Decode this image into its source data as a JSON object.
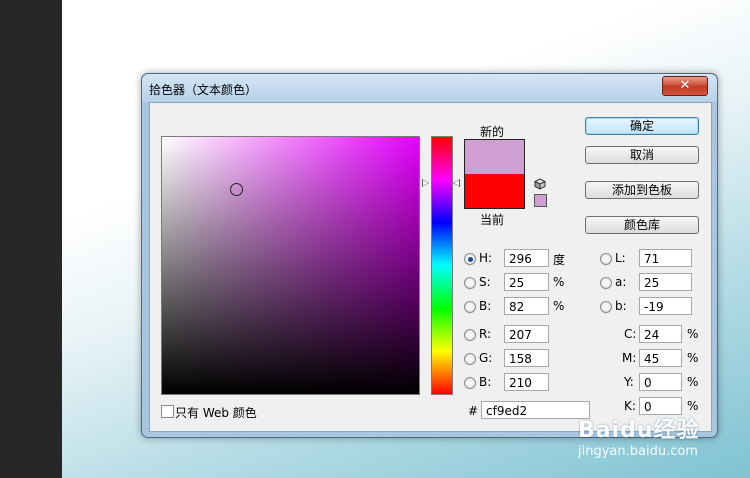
{
  "dialog": {
    "title": "拾色器（文本颜色）",
    "close_glyph": "✕"
  },
  "preview": {
    "new_label": "新的",
    "current_label": "当前",
    "new_color": "#cf9ed2",
    "current_color": "#ff0000"
  },
  "buttons": {
    "ok": "确定",
    "cancel": "取消",
    "add_to_swatches": "添加到色板",
    "color_libraries": "颜色库"
  },
  "hsb": {
    "h": {
      "label": "H:",
      "value": "296",
      "unit": "度",
      "selected": true
    },
    "s": {
      "label": "S:",
      "value": "25",
      "unit": "%"
    },
    "b": {
      "label": "B:",
      "value": "82",
      "unit": "%"
    }
  },
  "rgb": {
    "r": {
      "label": "R:",
      "value": "207"
    },
    "g": {
      "label": "G:",
      "value": "158"
    },
    "b": {
      "label": "B:",
      "value": "210"
    }
  },
  "lab": {
    "l": {
      "label": "L:",
      "value": "71"
    },
    "a": {
      "label": "a:",
      "value": "25"
    },
    "b": {
      "label": "b:",
      "value": "-19"
    }
  },
  "cmyk": {
    "c": {
      "label": "C:",
      "value": "24",
      "unit": "%"
    },
    "m": {
      "label": "M:",
      "value": "45",
      "unit": "%"
    },
    "y": {
      "label": "Y:",
      "value": "0",
      "unit": "%"
    },
    "k": {
      "label": "K:",
      "value": "0",
      "unit": "%"
    }
  },
  "hex": {
    "label": "#",
    "value": "cf9ed2"
  },
  "web_only": {
    "label": "只有 Web 颜色",
    "checked": false
  },
  "hue_base_color": "#e600ff",
  "watermark": {
    "brand": "Baidu经验",
    "url": "jingyan.baidu.com"
  }
}
